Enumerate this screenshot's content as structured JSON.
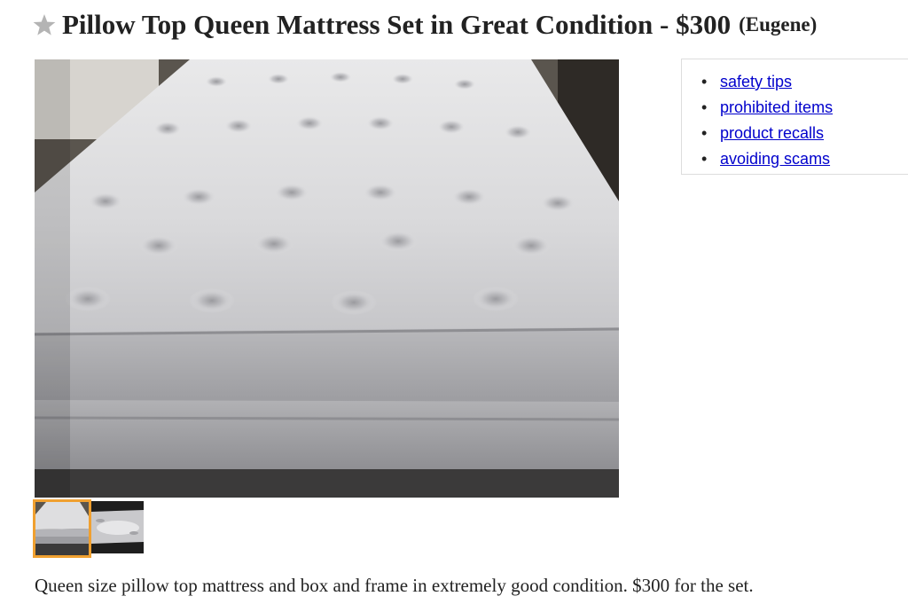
{
  "posting": {
    "title": "Pillow Top Queen Mattress Set in Great Condition - $300",
    "location": "(Eugene)",
    "favorite_icon": "star-icon",
    "description": "Queen size pillow top mattress and box and frame in extremely good condition. $300 for the set."
  },
  "gallery": {
    "main_image": "mattress-photo",
    "thumbnails": [
      {
        "name": "mattress-angle",
        "selected": true
      },
      {
        "name": "mattress-closeup",
        "selected": false
      }
    ],
    "selected_border_color": "#f0a030"
  },
  "safety_links": {
    "items": [
      {
        "label": "safety tips"
      },
      {
        "label": "prohibited items"
      },
      {
        "label": "product recalls"
      },
      {
        "label": "avoiding scams"
      }
    ],
    "link_color": "#0000cc"
  }
}
